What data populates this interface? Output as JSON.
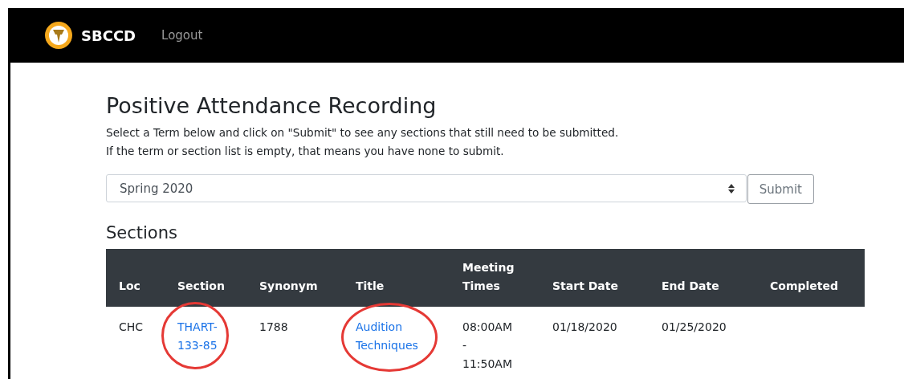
{
  "navbar": {
    "brand": "SBCCD",
    "links": [
      {
        "label": "Logout"
      }
    ]
  },
  "page": {
    "title": "Positive Attendance Recording",
    "description": [
      "Select a Term below and click on \"Submit\" to see any sections that still need to be submitted.",
      "If the term or section list is empty, that means you have none to submit."
    ]
  },
  "term_select": {
    "value": "Spring 2020",
    "button": "Submit"
  },
  "sections": {
    "heading": "Sections",
    "columns": [
      "Loc",
      "Section",
      "Synonym",
      "Title",
      "Meeting Times",
      "Start Date",
      "End Date",
      "Completed"
    ],
    "rows": [
      {
        "cells": [
          {
            "text": "CHC",
            "kind": "text",
            "circled": false
          },
          {
            "text": "THART-133-85",
            "kind": "link",
            "circled": true
          },
          {
            "text": "1788",
            "kind": "text",
            "circled": false
          },
          {
            "text": "Audition Techniques",
            "kind": "link",
            "circled": true
          },
          {
            "text": "08:00AM - 11:50AM",
            "kind": "text",
            "circled": false
          },
          {
            "text": "01/18/2020",
            "kind": "text",
            "circled": false
          },
          {
            "text": "01/25/2020",
            "kind": "text",
            "circled": false
          }
        ]
      }
    ]
  }
}
